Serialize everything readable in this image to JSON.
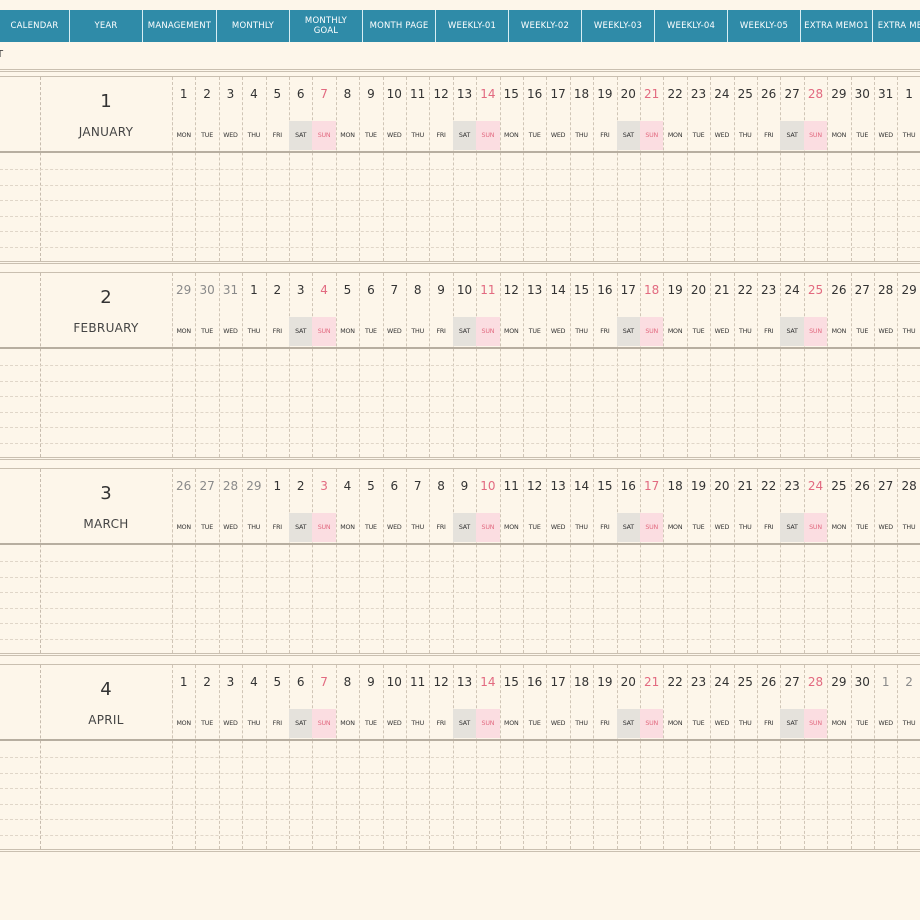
{
  "tabs": [
    {
      "label": "CALENDAR",
      "width": 70
    },
    {
      "label": "YEAR",
      "width": 73
    },
    {
      "label": "MANAGEMENT",
      "width": 74
    },
    {
      "label": "MONTHLY",
      "width": 73
    },
    {
      "label": "MONTHLY\nGOAL",
      "width": 73
    },
    {
      "label": "MONTH PAGE",
      "width": 73
    },
    {
      "label": "WEEKLY-01",
      "width": 73
    },
    {
      "label": "WEEKLY-02",
      "width": 73
    },
    {
      "label": "WEEKLY-03",
      "width": 73
    },
    {
      "label": "WEEKLY-04",
      "width": 73
    },
    {
      "label": "WEEKLY-05",
      "width": 73
    },
    {
      "label": "EXTRA MEMO1",
      "width": 72
    },
    {
      "label": "EXTRA ME",
      "width": 55
    }
  ],
  "stub_text": "T",
  "months": [
    {
      "number": "1",
      "name": "JANUARY",
      "days": [
        "1",
        "2",
        "3",
        "4",
        "5",
        "6",
        "7",
        "8",
        "9",
        "10",
        "11",
        "12",
        "13",
        "14",
        "15",
        "16",
        "17",
        "18",
        "19",
        "20",
        "21",
        "22",
        "23",
        "24",
        "25",
        "26",
        "27",
        "28",
        "29",
        "30",
        "31",
        "1"
      ],
      "leading_other": 0,
      "trailing_other": 0,
      "last_is_next": false
    },
    {
      "number": "2",
      "name": "FEBRUARY",
      "days": [
        "29",
        "30",
        "31",
        "1",
        "2",
        "3",
        "4",
        "5",
        "6",
        "7",
        "8",
        "9",
        "10",
        "11",
        "12",
        "13",
        "14",
        "15",
        "16",
        "17",
        "18",
        "19",
        "20",
        "21",
        "22",
        "23",
        "24",
        "25",
        "26",
        "27",
        "28",
        "29"
      ],
      "leading_other": 3,
      "trailing_other": 0
    },
    {
      "number": "3",
      "name": "MARCH",
      "days": [
        "26",
        "27",
        "28",
        "29",
        "1",
        "2",
        "3",
        "4",
        "5",
        "6",
        "7",
        "8",
        "9",
        "10",
        "11",
        "12",
        "13",
        "14",
        "15",
        "16",
        "17",
        "18",
        "19",
        "20",
        "21",
        "22",
        "23",
        "24",
        "25",
        "26",
        "27",
        "28"
      ],
      "leading_other": 4,
      "trailing_other": 0
    },
    {
      "number": "4",
      "name": "APRIL",
      "days": [
        "1",
        "2",
        "3",
        "4",
        "5",
        "6",
        "7",
        "8",
        "9",
        "10",
        "11",
        "12",
        "13",
        "14",
        "15",
        "16",
        "17",
        "18",
        "19",
        "20",
        "21",
        "22",
        "23",
        "24",
        "25",
        "26",
        "27",
        "28",
        "29",
        "30",
        "1",
        "2"
      ],
      "leading_other": 0,
      "trailing_other": 2
    }
  ],
  "weekdays": [
    "MON",
    "TUE",
    "WED",
    "THU",
    "FRI",
    "SAT",
    "SUN"
  ]
}
